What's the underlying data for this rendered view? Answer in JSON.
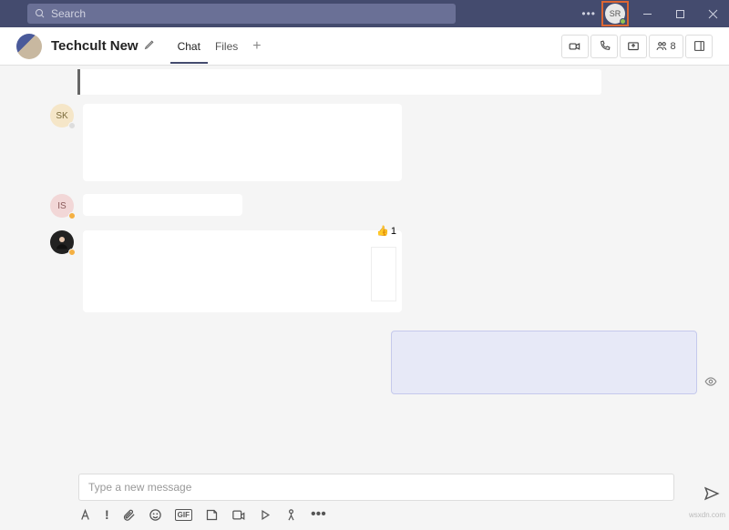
{
  "titlebar": {
    "search_placeholder": "Search",
    "profile_initials": "SR"
  },
  "header": {
    "chat_title": "Techcult New",
    "tabs": {
      "chat": "Chat",
      "files": "Files"
    },
    "participants_count": "8"
  },
  "messages": {
    "sk_initials": "SK",
    "is_initials": "IS",
    "reaction_emoji": "👍",
    "reaction_count": "1"
  },
  "composer": {
    "placeholder": "Type a new message",
    "gif_label": "GIF"
  },
  "watermark": "wsxdn.com"
}
